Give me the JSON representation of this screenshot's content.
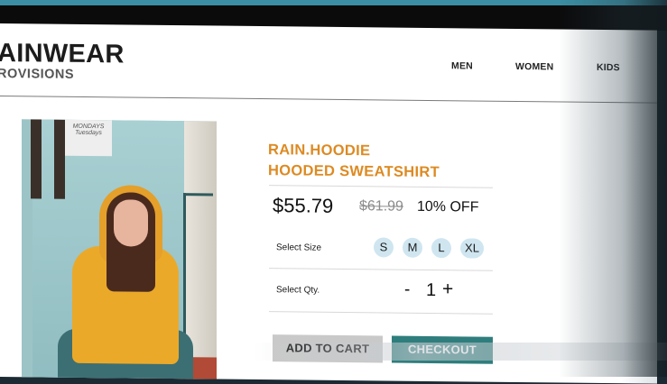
{
  "brand": {
    "name": "AINWEAR",
    "sub": "ROVISIONS"
  },
  "nav": {
    "men": "MEN",
    "women": "WOMEN",
    "kids": "KIDS"
  },
  "product": {
    "title_line1": "RAIN.HOODIE",
    "title_line2": "HOODED SWEATSHIRT",
    "price": "$55.79",
    "old_price": "$61.99",
    "discount": "10% OFF",
    "size_label": "Select Size",
    "sizes": [
      "S",
      "M",
      "L",
      "XL"
    ],
    "qty_label": "Select Qty.",
    "qty_minus": "-",
    "qty_value": "1",
    "qty_plus": "+",
    "photo_sign": "MONDAYS Tuesdays"
  },
  "buttons": {
    "add_to_cart": "ADD TO CART",
    "checkout": "CHECKOUT"
  },
  "colors": {
    "accent_orange": "#dd8a22",
    "checkout_teal": "#2f7e7d",
    "size_chip": "#cfe6f0"
  }
}
